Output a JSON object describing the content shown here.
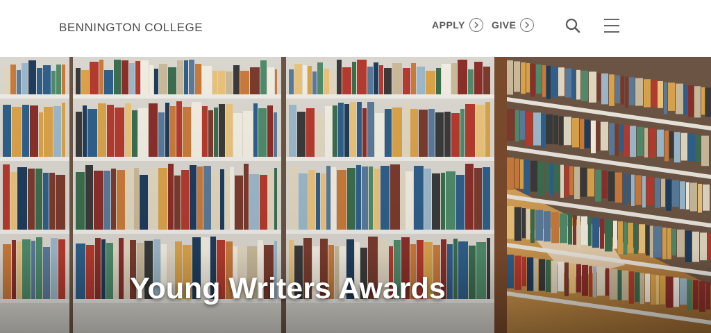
{
  "header": {
    "logo_text": "BENNINGTON COLLEGE",
    "nav": [
      {
        "label": "APPLY",
        "icon": "chevron-right-circle-icon"
      },
      {
        "label": "GIVE",
        "icon": "chevron-right-circle-icon"
      }
    ],
    "search_icon": "search-icon",
    "menu_icon": "hamburger-menu-icon"
  },
  "hero": {
    "title": "Young Writers Awards",
    "image_subject": "library bookshelves"
  },
  "colors": {
    "header_bg": "#ffffff",
    "text_dark": "#4a4a4a",
    "hero_text": "#ffffff"
  }
}
